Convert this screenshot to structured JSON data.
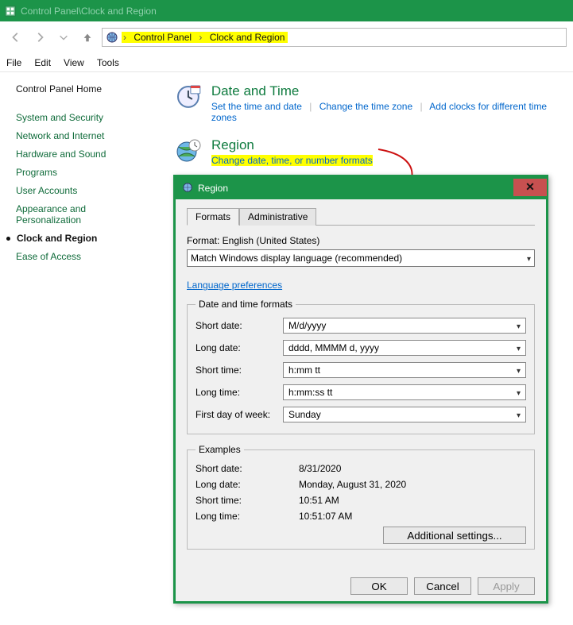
{
  "titlebar": {
    "text": "Control Panel\\Clock and Region"
  },
  "breadcrumb": {
    "seg1": "Control Panel",
    "seg2": "Clock and Region"
  },
  "menu": {
    "file": "File",
    "edit": "Edit",
    "view": "View",
    "tools": "Tools"
  },
  "sidebar": {
    "home": "Control Panel Home",
    "items": [
      "System and Security",
      "Network and Internet",
      "Hardware and Sound",
      "Programs",
      "User Accounts",
      "Appearance and Personalization"
    ],
    "current": "Clock and Region",
    "last": "Ease of Access"
  },
  "sections": {
    "datetime": {
      "title": "Date and Time",
      "l1": "Set the time and date",
      "l2": "Change the time zone",
      "l3": "Add clocks for different time zones"
    },
    "region": {
      "title": "Region",
      "l1": "Change date, time, or number formats"
    }
  },
  "dialog": {
    "title": "Region",
    "tabs": {
      "formats": "Formats",
      "admin": "Administrative"
    },
    "format_label": "Format: English (United States)",
    "format_value": "Match Windows display language (recommended)",
    "lang_pref": "Language preferences",
    "group_formats": "Date and time formats",
    "rows": {
      "short_date_l": "Short date:",
      "short_date_v": "M/d/yyyy",
      "long_date_l": "Long date:",
      "long_date_v": "dddd, MMMM d, yyyy",
      "short_time_l": "Short time:",
      "short_time_v": "h:mm tt",
      "long_time_l": "Long time:",
      "long_time_v": "h:mm:ss tt",
      "first_day_l": "First day of week:",
      "first_day_v": "Sunday"
    },
    "group_examples": "Examples",
    "ex": {
      "sd_l": "Short date:",
      "sd_v": "8/31/2020",
      "ld_l": "Long date:",
      "ld_v": "Monday, August 31, 2020",
      "st_l": "Short time:",
      "st_v": "10:51 AM",
      "lt_l": "Long time:",
      "lt_v": "10:51:07 AM"
    },
    "additional": "Additional settings...",
    "ok": "OK",
    "cancel": "Cancel",
    "apply": "Apply"
  }
}
